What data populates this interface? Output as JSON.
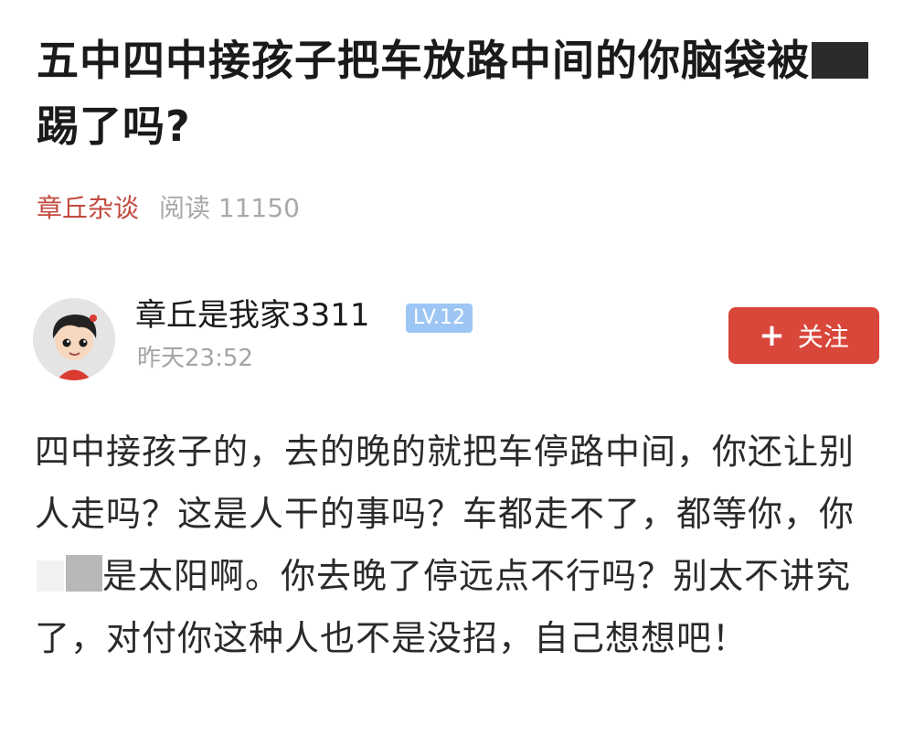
{
  "post": {
    "title_main": "五中四中接孩子把车放路中间的你脑袋被",
    "title_end": "踢了吗?",
    "source": "章丘杂谈",
    "reads": "阅读 11150"
  },
  "author": {
    "name": "章丘是我家3311",
    "level": "LV.12",
    "time": "昨天23:52",
    "follow_icon": "plus-icon",
    "follow_label": "关注"
  },
  "content": {
    "part1": "四中接孩子的，去的晚的就把车停路中间，你还让别人走吗？这是人干的事吗？车都走不了，都等你，你",
    "part2": "是太阳啊。你去晚了停远点不行吗？别太不讲究了，对付你这种人也不是没招，自己想想吧！"
  },
  "colors": {
    "source": "#c24a3e",
    "follow_bg": "#d9463a",
    "level_bg": "#9ec6f5"
  }
}
